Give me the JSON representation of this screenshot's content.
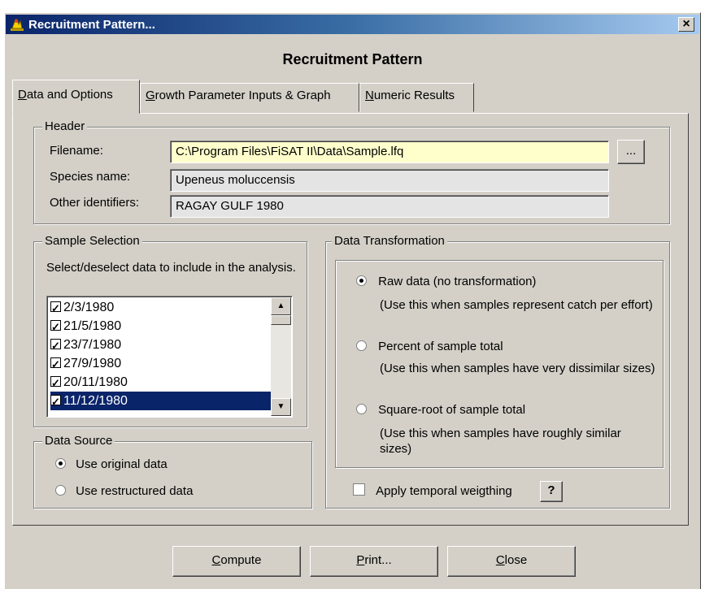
{
  "window": {
    "title": "Recruitment Pattern...",
    "close_label": "×"
  },
  "heading": "Recruitment Pattern",
  "tabs": [
    {
      "label": "Data and Options",
      "key": "D",
      "rest": "ata and Options"
    },
    {
      "label": "Growth Parameter Inputs & Graph",
      "key": "G",
      "rest": "rowth Parameter Inputs & Graph"
    },
    {
      "label": "Numeric Results",
      "key": "N",
      "rest": "umeric Results"
    }
  ],
  "header": {
    "legend": "Header",
    "filename_label": "Filename:",
    "filename_value": "C:\\Program Files\\FiSAT II\\Data\\Sample.lfq",
    "browse_label": "...",
    "species_label": "Species name:",
    "species_value": "Upeneus moluccensis",
    "other_label": "Other identifiers:",
    "other_value": "RAGAY GULF 1980"
  },
  "sample_selection": {
    "legend": "Sample Selection",
    "instruction": "Select/deselect data to include in the analysis.",
    "items": [
      {
        "label": "2/3/1980",
        "checked": true,
        "selected": false
      },
      {
        "label": "21/5/1980",
        "checked": true,
        "selected": false
      },
      {
        "label": "23/7/1980",
        "checked": true,
        "selected": false
      },
      {
        "label": "27/9/1980",
        "checked": true,
        "selected": false
      },
      {
        "label": "20/11/1980",
        "checked": true,
        "selected": false
      },
      {
        "label": "11/12/1980",
        "checked": true,
        "selected": true
      }
    ]
  },
  "data_source": {
    "legend": "Data Source",
    "options": [
      {
        "label": "Use original data",
        "selected": true
      },
      {
        "label": "Use restructured data",
        "selected": false
      }
    ]
  },
  "data_transformation": {
    "legend": "Data Transformation",
    "options": [
      {
        "label": "Raw data (no transformation)",
        "desc": "(Use this when samples represent catch per effort)",
        "selected": true
      },
      {
        "label": "Percent of sample total",
        "desc": "(Use this when samples have very dissimilar sizes)",
        "selected": false
      },
      {
        "label": "Square-root of sample total",
        "desc": "(Use this when samples have roughly similar sizes)",
        "selected": false
      }
    ],
    "weighting_label": "Apply temporal weigthing",
    "weighting_checked": false,
    "help_label": "?"
  },
  "buttons": {
    "compute": {
      "label": "Compute",
      "key": "C",
      "rest": "ompute"
    },
    "print": {
      "label": "Print...",
      "key": "P",
      "rest": "rint..."
    },
    "close": {
      "label": "Close",
      "key": "C",
      "rest": "lose"
    }
  },
  "colors": {
    "face": "#d4d0c8",
    "title_start": "#0a246a",
    "title_end": "#a6caf0",
    "highlight_field": "#ffffcc",
    "selection": "#0a246a"
  }
}
